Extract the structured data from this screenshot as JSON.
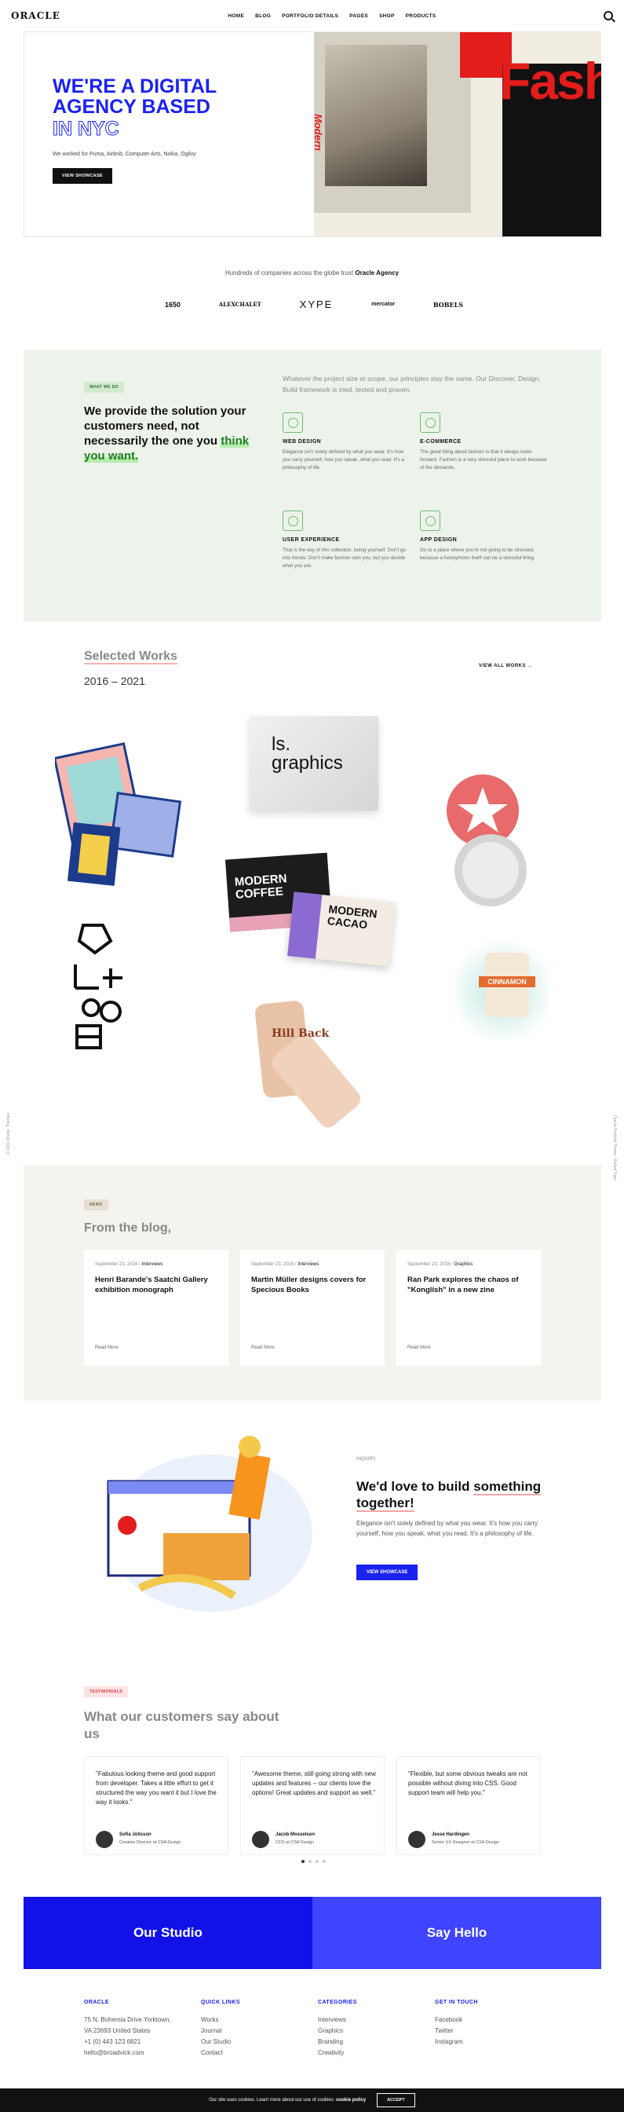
{
  "header": {
    "logo": "ORACLE",
    "nav": [
      "HOME",
      "BLOG",
      "PORTFOLIO DETAILS",
      "PAGES",
      "SHOP",
      "PRODUCTS"
    ]
  },
  "hero": {
    "title": "WE'RE A DIGITAL AGENCY BASED",
    "title_outline": "IN NYC",
    "sub": "We worked for Puma, Airbnb, Computer Arts, Nokia, Ogilvy",
    "button": "VIEW SHOWCASE",
    "fash": "Fash",
    "modern": "Modern"
  },
  "trust": {
    "text": "Hundreds of companies across the globe trust",
    "brand": "Oracle Agency",
    "logos": [
      "1650",
      "ALEXCHALET",
      "XYPE",
      "mercator",
      "BOBELS"
    ]
  },
  "services": {
    "tag": "WHAT WE DO",
    "headline_a": "We provide the solution your customers need, not necessarily the one you",
    "headline_b": "think you want.",
    "intro": "Whatever the project size or scope, our principles stay the same. Our Discover, Design, Build framework is tried, tested and proven.",
    "items": [
      {
        "title": "WEB DESIGN",
        "text": "Elegance isn't solely defined by what you wear. It's how you carry yourself, how you speak, what you read. It's a philosophy of life."
      },
      {
        "title": "E-COMMERCE",
        "text": "The great thing about fashion is that it always looks forward. Fashion is a very stressful place to work because of the demands."
      },
      {
        "title": "USER EXPERIENCE",
        "text": "That is the key of this collection, being yourself. Don't go into trends. Don't make fashion own you, but you decide what you are."
      },
      {
        "title": "APP DESIGN",
        "text": "Go to a place where you're not going to be stressed, because a honeymoon itself can be a stressful thing."
      }
    ]
  },
  "works": {
    "title": "Selected Works",
    "years": "2016 – 2021",
    "view_all": "VIEW ALL WORKS",
    "ls": "ls.",
    "graphics": "graphics",
    "coffee": "MODERN COFFEE",
    "cacao": "MODERN CACAO",
    "cinnamon": "CINNAMON",
    "hill": "Hill Back"
  },
  "blog": {
    "tag": "NEWS",
    "title": "From the blog,",
    "posts": [
      {
        "date": "September 23, 2016",
        "cat": "Interviews",
        "title": "Henri Barande's Saatchi Gallery exhibition monograph",
        "more": "Read More"
      },
      {
        "date": "September 23, 2016",
        "cat": "Interviews",
        "title": "Martin Müller designs covers for Specious Books",
        "more": "Read More"
      },
      {
        "date": "September 23, 2016",
        "cat": "Graphics",
        "title": "Ran Park explores the chaos of \"Konglish\" in a new zine",
        "more": "Read More"
      }
    ]
  },
  "cta": {
    "sub": "INQUIRY",
    "title_a": "We'd love to build",
    "title_b": "something together!",
    "text": "Elegance isn't solely defined by what you wear. It's how you carry yourself, how you speak, what you read. It's a philosophy of life.",
    "button": "VIEW SHOWCASE"
  },
  "testimonials": {
    "tag": "TESTIMONIALS",
    "title": "What our customers say about us",
    "items": [
      {
        "quote": "\"Fabulous looking theme and good support from developer. Takes a little effort to get it structured the way you want it but I love the way it looks.\"",
        "name": "Sofia Jolisson",
        "role": "Creative Director at CSA Design"
      },
      {
        "quote": "\"Awesome theme, still going strong with new updates and features -- our clients love the options! Great updates and support as well.\"",
        "name": "Jacob Mosselson",
        "role": "CFO at CSA Design"
      },
      {
        "quote": "\"Flexible, but some obvious tweaks are not possible without diving into CSS. Good support team will help you.\"",
        "name": "Jesse Hardingen",
        "role": "Senior UX Designer at CSA Design"
      }
    ]
  },
  "studio": {
    "left": "Our Studio",
    "right": "Say Hello"
  },
  "footer": {
    "cols": [
      {
        "title": "ORACLE",
        "lines": [
          "75 N. Bohemia Drive Yorktown,",
          "VA 23693 United States",
          "+1 (0) 443 123 6821",
          "hello@broadvick.com"
        ]
      },
      {
        "title": "QUICK LINKS",
        "lines": [
          "Works",
          "Journal",
          "Our Studio",
          "Contact"
        ]
      },
      {
        "title": "CATEGORIES",
        "lines": [
          "Interviews",
          "Graphics",
          "Branding",
          "Creativity"
        ]
      },
      {
        "title": "GET IN TOUCH",
        "lines": [
          "Facebook",
          "Twitter",
          "Instagram"
        ]
      }
    ]
  },
  "cookie": {
    "text": "Our site uses cookies. Learn more about our use of cookies:",
    "link": "cookie policy",
    "button": "ACCEPT"
  },
  "side": {
    "left": "© 2021 Oracle. Themes",
    "right": "Oracle Portfolio Theme - Rafael Tiger"
  },
  "colors": {
    "accent": "#1a22ee",
    "red": "#e31c1c",
    "green_bg": "#edf3eb"
  }
}
